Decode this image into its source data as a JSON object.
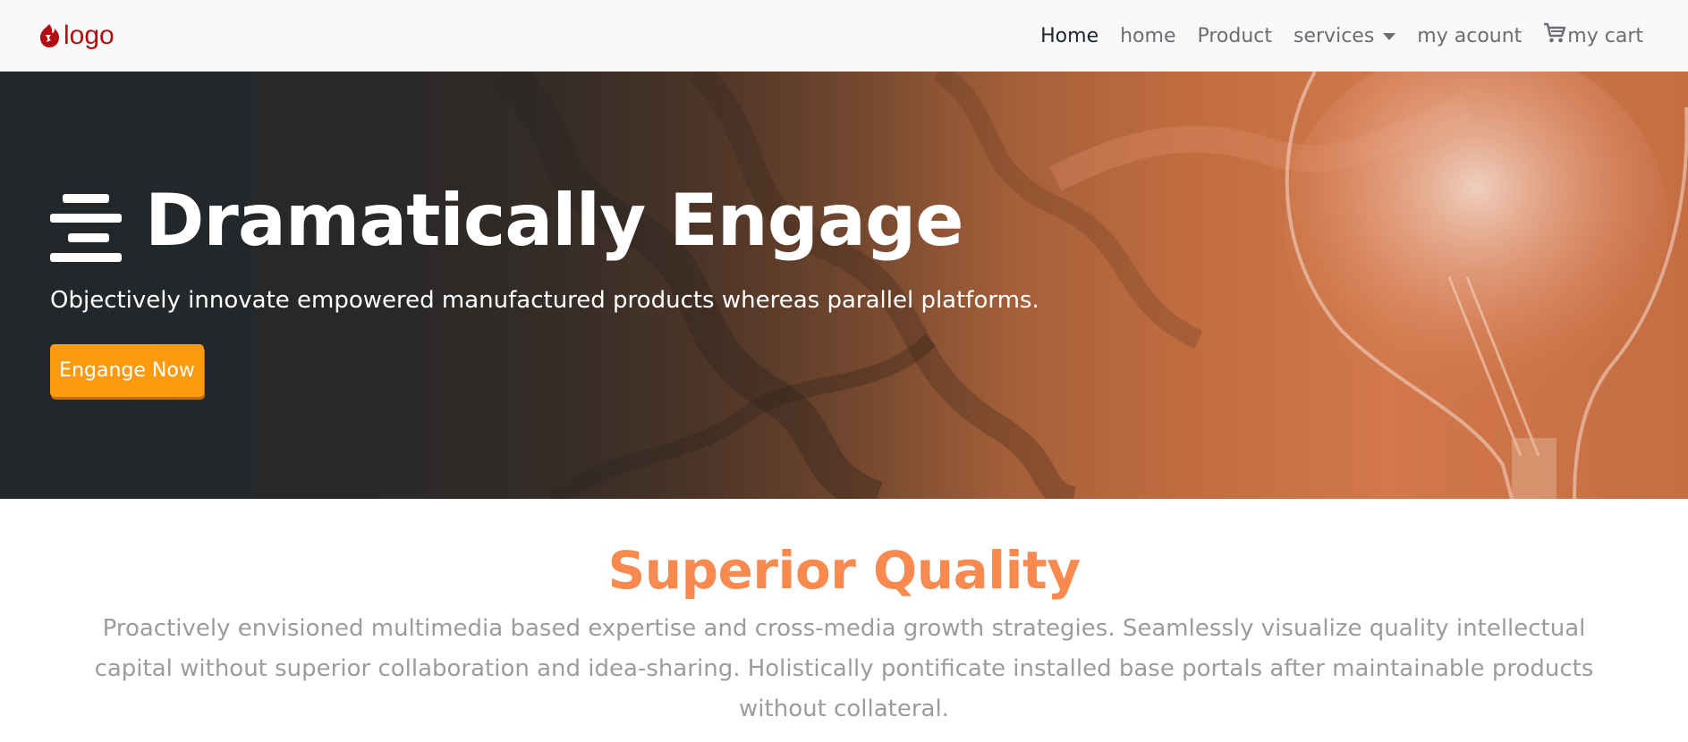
{
  "navbar": {
    "brand": {
      "text": "logo",
      "icon": "flame-logo-icon",
      "color": "#b10f0f"
    },
    "links": [
      {
        "label": "Home",
        "active": true
      },
      {
        "label": "home"
      },
      {
        "label": "Product"
      },
      {
        "label": "services",
        "dropdown": true
      },
      {
        "label": "my acount"
      },
      {
        "label": "my cart",
        "icon": "cart-icon"
      }
    ]
  },
  "hero": {
    "icon": "menu-lines-icon",
    "title": "Dramatically Engage",
    "subtitle": "Objectively innovate empowered manufactured products whereas parallel platforms.",
    "button_label": "Engange Now",
    "button_color": "#fd9a0f",
    "background": "wood-and-lightbulb-photo"
  },
  "section": {
    "title": "Superior Quality",
    "title_color": "#f88a4f",
    "body": "Proactively envisioned multimedia based expertise and cross-media growth strategies. Seamlessly visualize quality intellectual capital without superior collaboration and idea-sharing. Holistically pontificate installed base portals after maintainable products without collateral."
  }
}
